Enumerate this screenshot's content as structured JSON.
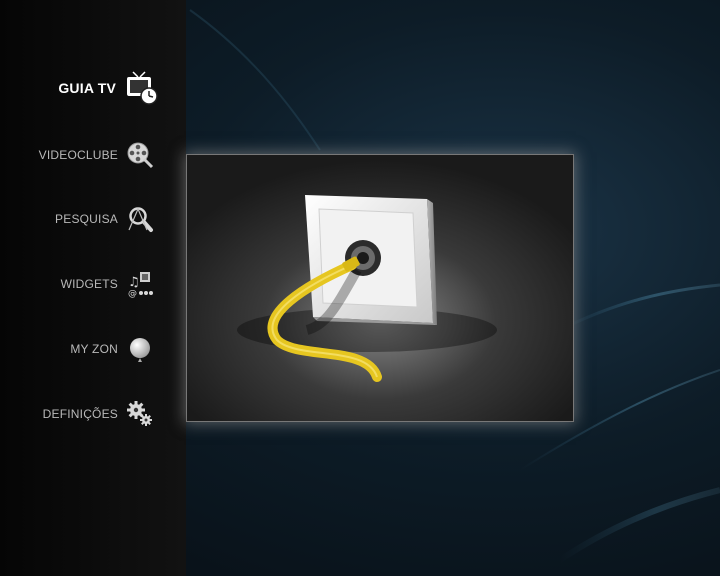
{
  "menu": {
    "items": [
      {
        "label": "GUIA TV",
        "icon": "tv-guide-icon",
        "active": true
      },
      {
        "label": "VIDEOCLUBE",
        "icon": "film-reel-icon",
        "active": false
      },
      {
        "label": "PESQUISA",
        "icon": "search-icon",
        "active": false
      },
      {
        "label": "WIDGETS",
        "icon": "widgets-icon",
        "active": false
      },
      {
        "label": "MY ZON",
        "icon": "balloon-icon",
        "active": false
      },
      {
        "label": "DEFINIÇÕES",
        "icon": "gear-icon",
        "active": false
      }
    ]
  },
  "preview": {
    "icon": "antenna-socket-cable-icon"
  },
  "colors": {
    "cable": "#e6c620",
    "background": "#0d1c27",
    "sidebar": "#0b0b0b"
  }
}
